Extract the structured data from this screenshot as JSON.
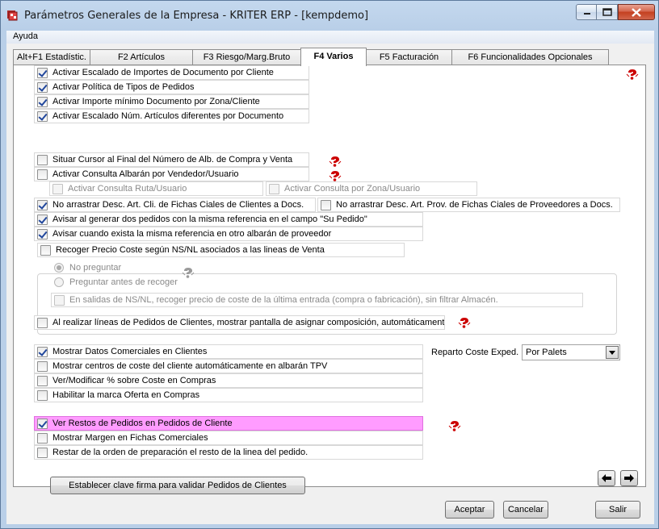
{
  "window": {
    "title": "Parámetros Generales de la Empresa - KRITER ERP - [kempdemo]"
  },
  "menu": {
    "ayuda": "Ayuda"
  },
  "tabs": [
    {
      "label": "Alt+F1 Estadístic."
    },
    {
      "label": "F2 Artículos"
    },
    {
      "label": "F3 Riesgo/Marg.Bruto"
    },
    {
      "label": "F4 Varios",
      "active": true
    },
    {
      "label": "F5 Facturación"
    },
    {
      "label": "F6 Funcionalidades Opcionales"
    }
  ],
  "options": {
    "escalado_importes": {
      "label": "Activar Escalado de Importes de Documento por Cliente",
      "checked": true
    },
    "politica_tipos": {
      "label": "Activar Política de Tipos de Pedidos",
      "checked": true
    },
    "importe_minimo": {
      "label": "Activar Importe mínimo Documento por Zona/Cliente",
      "checked": true
    },
    "escalado_articulos": {
      "label": "Activar Escalado Núm. Artículos diferentes por Documento",
      "checked": true
    },
    "situar_cursor": {
      "label": "Situar Cursor al Final del Número de Alb. de Compra y Venta",
      "checked": false
    },
    "consulta_albaran": {
      "label": "Activar Consulta Albarán por Vendedor/Usuario",
      "checked": false
    },
    "consulta_ruta": {
      "label": "Activar Consulta Ruta/Usuario",
      "checked": false
    },
    "consulta_zona": {
      "label": "Activar Consulta por Zona/Usuario",
      "checked": false
    },
    "no_arrastrar_cli": {
      "label": "No arrastrar Desc. Art. Cli. de Fichas Ciales de Clientes a Docs.",
      "checked": true
    },
    "no_arrastrar_prov": {
      "label": "No arrastrar Desc. Art. Prov. de Fichas Ciales de Proveedores a Docs.",
      "checked": false
    },
    "avisar_pedidos": {
      "label": "Avisar al generar dos pedidos con la misma referencia en el campo \"Su Pedido\"",
      "checked": true
    },
    "avisar_albaran": {
      "label": "Avisar cuando exista la misma referencia en otro albarán de proveedor",
      "checked": true
    },
    "recoger_precio": {
      "label": "Recoger Precio Coste según NS/NL asociados a las lineas de Venta",
      "checked": false
    },
    "salidas_ns": {
      "label": "En salidas de NS/NL, recoger precio de coste de la última entrada (compra o fabricación), sin filtrar Almacén.",
      "checked": false
    },
    "asignar_composicion": {
      "label": "Al realizar líneas de Pedidos de Clientes, mostrar pantalla de asignar composición, automáticamente",
      "checked": false
    },
    "datos_comerciales": {
      "label": "Mostrar Datos Comerciales en Clientes",
      "checked": true
    },
    "centros_coste": {
      "label": "Mostrar centros de coste del cliente automáticamente en albarán TPV",
      "checked": false
    },
    "modificar_coste": {
      "label": "Ver/Modificar % sobre Coste en Compras",
      "checked": false
    },
    "marca_oferta": {
      "label": "Habilitar la marca Oferta en Compras",
      "checked": false
    },
    "restos_pedidos": {
      "label": "Ver Restos de Pedidos en Pedidos de Cliente",
      "checked": true
    },
    "margen_fichas": {
      "label": "Mostrar Margen en Fichas Comerciales",
      "checked": false
    },
    "restar_orden": {
      "label": "Restar de la orden de preparación el resto de la linea del pedido.",
      "checked": false
    }
  },
  "radios": {
    "no_preguntar": {
      "label": "No preguntar",
      "selected": true
    },
    "preguntar": {
      "label": "Preguntar antes de recoger",
      "selected": false
    }
  },
  "reparto": {
    "label": "Reparto Coste Exped.",
    "value": "Por Palets"
  },
  "buttons": {
    "clave_firma": "Establecer clave firma para validar Pedidos de Clientes",
    "aceptar": "Aceptar",
    "cancelar": "Cancelar",
    "salir": "Salir"
  },
  "colors": {
    "highlight_row": "#ff9cff",
    "help_icon": "#cc0000"
  },
  "icons": [
    "app-icon",
    "help-icon",
    "arrow-left-icon",
    "arrow-right-icon",
    "chevron-down-icon"
  ]
}
